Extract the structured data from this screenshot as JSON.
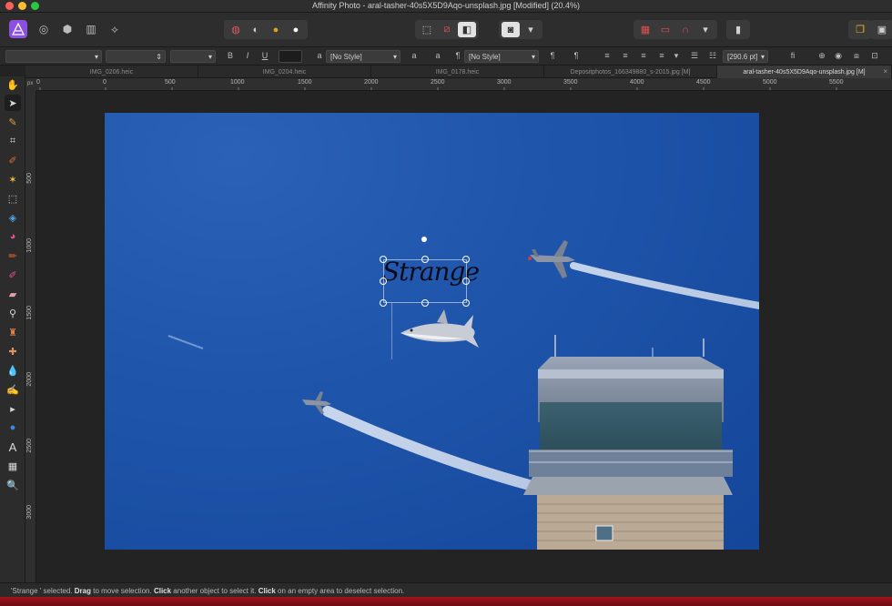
{
  "window": {
    "title": "Affinity Photo - aral-tasher-40s5X5D9Aqo-unsplash.jpg [Modified] (20.4%)"
  },
  "context_toolbar": {
    "font_family": "",
    "font_style": "",
    "font_size": "",
    "bold": "B",
    "italic": "I",
    "underline": "U",
    "char_style": "[No Style]",
    "para_style": "[No Style]",
    "leading": "[290.6 pt]",
    "ligature": "fi"
  },
  "tabs": [
    {
      "label": "IMG_0206.heic"
    },
    {
      "label": "IMG_0204.heic"
    },
    {
      "label": "IMG_0178.heic"
    },
    {
      "label": "Depositphotos_166349880_s-2015.jpg [M]"
    },
    {
      "label": "aral-tasher-40s5X5D9Aqo-unsplash.jpg [M]"
    }
  ],
  "ruler": {
    "unit": "px",
    "h_labels": [
      "0",
      "500",
      "1000",
      "1500",
      "2000",
      "2500",
      "3000",
      "3500",
      "4000",
      "4500",
      "5000",
      "5500"
    ],
    "v_labels": [
      "500",
      "1000",
      "1500",
      "2000",
      "2500",
      "3000"
    ]
  },
  "canvas": {
    "text_layer": "Strange"
  },
  "status": {
    "selected": "'Strange ' selected.",
    "drag": "Drag",
    "drag_rest": " to move selection.",
    "click1": "Click",
    "click1_rest": " another object to select it.",
    "click2": "Click",
    "click2_rest": " on an empty area to deselect selection."
  },
  "colors": {
    "persona_active": "#8d4fe0",
    "sky": "#1f56ac",
    "text_fill": "#000000"
  }
}
